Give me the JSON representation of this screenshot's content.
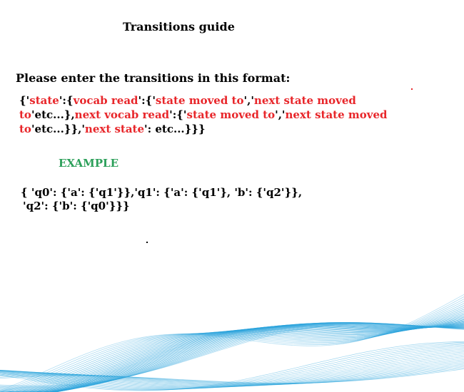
{
  "title": "Transitions guide",
  "instruction": "Please enter the transitions in this format:",
  "format": {
    "segments": [
      {
        "text": "{'",
        "color": "black"
      },
      {
        "text": "state",
        "color": "red"
      },
      {
        "text": "':{",
        "color": "black"
      },
      {
        "text": "vocab read",
        "color": "red"
      },
      {
        "text": "':{'",
        "color": "black"
      },
      {
        "text": "state moved to",
        "color": "red"
      },
      {
        "text": "','",
        "color": "black"
      },
      {
        "text": "next state moved to",
        "color": "red"
      },
      {
        "text": "'etc...},",
        "color": "black"
      },
      {
        "text": "next vocab read",
        "color": "red"
      },
      {
        "text": "':{'",
        "color": "black"
      },
      {
        "text": "state moved to",
        "color": "red"
      },
      {
        "text": "','",
        "color": "black"
      },
      {
        "text": "next state moved to",
        "color": "red"
      },
      {
        "text": "'etc...}},'",
        "color": "black"
      },
      {
        "text": "next state",
        "color": "red"
      },
      {
        "text": "': etc...}}}",
        "color": "black"
      }
    ]
  },
  "example_label": "EXAMPLE",
  "example": {
    "line1": "{ 'q0': {'a': {'q1'}},'q1': {'a': {'q1'}, 'b': {'q2'}},",
    "line2": "'q2': {'b': {'q0'}}}"
  },
  "colors": {
    "accent_red": "#e8262a",
    "accent_green": "#2ca05a",
    "wave_blue": "#2ba3dc"
  }
}
